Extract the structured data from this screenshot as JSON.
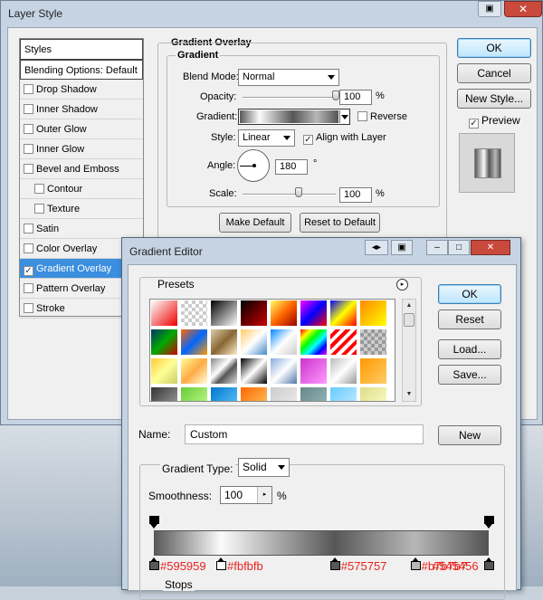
{
  "layer_style": {
    "title": "Layer Style",
    "styles_header": "Styles",
    "blending_options": "Blending Options: Default",
    "styles": [
      {
        "label": "Drop Shadow",
        "checked": false,
        "indent": false,
        "selected": false
      },
      {
        "label": "Inner Shadow",
        "checked": false,
        "indent": false,
        "selected": false
      },
      {
        "label": "Outer Glow",
        "checked": false,
        "indent": false,
        "selected": false
      },
      {
        "label": "Inner Glow",
        "checked": false,
        "indent": false,
        "selected": false
      },
      {
        "label": "Bevel and Emboss",
        "checked": false,
        "indent": false,
        "selected": false
      },
      {
        "label": "Contour",
        "checked": false,
        "indent": true,
        "selected": false
      },
      {
        "label": "Texture",
        "checked": false,
        "indent": true,
        "selected": false
      },
      {
        "label": "Satin",
        "checked": false,
        "indent": false,
        "selected": false
      },
      {
        "label": "Color Overlay",
        "checked": false,
        "indent": false,
        "selected": false
      },
      {
        "label": "Gradient Overlay",
        "checked": true,
        "indent": false,
        "selected": true
      },
      {
        "label": "Pattern Overlay",
        "checked": false,
        "indent": false,
        "selected": false
      },
      {
        "label": "Stroke",
        "checked": false,
        "indent": false,
        "selected": false
      }
    ],
    "panel_title": "Gradient Overlay",
    "section_title": "Gradient",
    "blend_mode_label": "Blend Mode:",
    "blend_mode_value": "Normal",
    "opacity_label": "Opacity:",
    "opacity_value": "100",
    "opacity_fraction": 1.0,
    "percent": "%",
    "gradient_label": "Gradient:",
    "reverse_label": "Reverse",
    "reverse_checked": false,
    "style_label": "Style:",
    "style_value": "Linear",
    "align_label": "Align with Layer",
    "align_checked": true,
    "angle_label": "Angle:",
    "angle_value": "180",
    "degree": "°",
    "scale_label": "Scale:",
    "scale_value": "100",
    "scale_fraction": 0.6,
    "make_default": "Make Default",
    "reset_default": "Reset to Default",
    "ok": "OK",
    "cancel": "Cancel",
    "new_style": "New Style...",
    "preview_label": "Preview",
    "preview_checked": true
  },
  "gradient_editor": {
    "title": "Gradient Editor",
    "presets_label": "Presets",
    "ok": "OK",
    "reset": "Reset",
    "load": "Load...",
    "save": "Save...",
    "name_label": "Name:",
    "name_value": "Custom",
    "new_button": "New",
    "gradient_type_label": "Gradient Type:",
    "gradient_type_value": "Solid",
    "smoothness_label": "Smoothness:",
    "smoothness_value": "100",
    "percent": "%",
    "stops_label": "Stops",
    "color_stops": [
      "#595959",
      "#fbfbfb",
      "#575757",
      "#b7b7b7",
      "#545456"
    ],
    "stop_positions": [
      0,
      0.2,
      0.54,
      0.78,
      1.0
    ],
    "accent_hex_color": "#e8231e"
  },
  "colors": {
    "selected_row": "#3b8fde",
    "close_button": "#c94a3d"
  }
}
